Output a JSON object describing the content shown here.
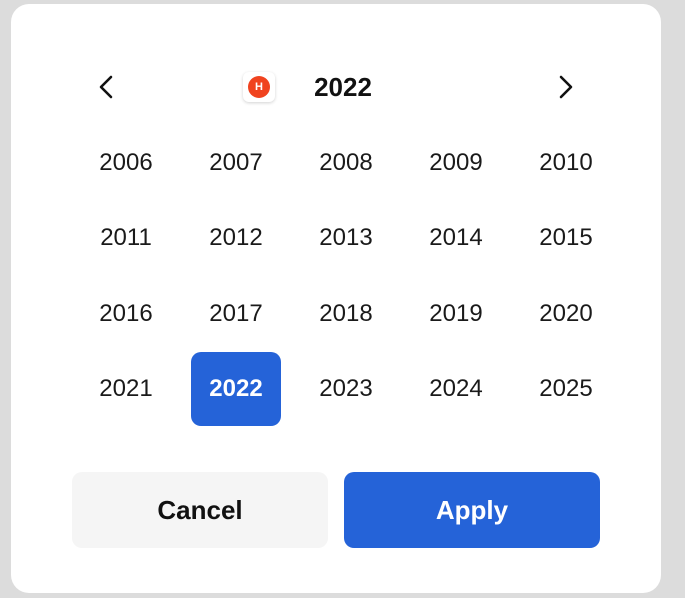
{
  "header": {
    "title": "2022",
    "badge_letter": "H",
    "prev_icon": "chevron-left-icon",
    "next_icon": "chevron-right-icon"
  },
  "years": [
    "2006",
    "2007",
    "2008",
    "2009",
    "2010",
    "2011",
    "2012",
    "2013",
    "2014",
    "2015",
    "2016",
    "2017",
    "2018",
    "2019",
    "2020",
    "2021",
    "2022",
    "2023",
    "2024",
    "2025"
  ],
  "selected_year": "2022",
  "actions": {
    "cancel_label": "Cancel",
    "apply_label": "Apply"
  },
  "colors": {
    "accent": "#2563d8",
    "badge": "#f0431f",
    "cancel_bg": "#f5f5f5",
    "backdrop": "#dcdcdc"
  }
}
